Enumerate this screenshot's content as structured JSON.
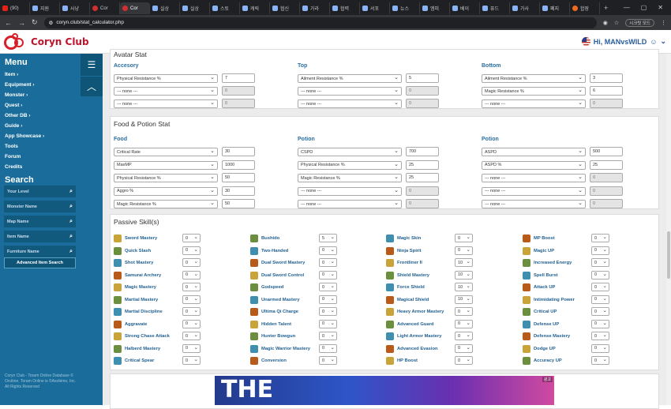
{
  "browser": {
    "tabs": [
      "(90)",
      "지원",
      "사냥",
      "Cor",
      "Cor",
      "실상",
      "실상",
      "스토",
      "캐릭",
      "협신",
      "가라",
      "협력",
      "서포",
      "뉴스",
      "엠피",
      "베이",
      "퓨드",
      "가사",
      "폐지",
      "합장"
    ],
    "active_tab": 4,
    "url": "coryn.club/stat_calculator.php",
    "secret_mode": "시크릿 모드"
  },
  "header": {
    "logo_text": "Coryn Club",
    "greeting": "Hi, MANvsWILD"
  },
  "sidebar": {
    "menu_title": "Menu",
    "items": [
      "Item",
      "Equipment",
      "Monster",
      "Quest",
      "Other DB",
      "Guide",
      "App Showcase",
      "Tools",
      "Forum",
      "Credits"
    ],
    "search_title": "Search",
    "search_fields": [
      "Your Level",
      "Monster Name",
      "Map Name",
      "Item Name",
      "Furniture Name"
    ],
    "advanced_search": "Advanced Item Search",
    "footnote": "Coryn Club - Toram Online Database © Orcitine. Toram Online is ©Asobimo, Inc. All Rights Reserved"
  },
  "avatar": {
    "title_partial": "Avatar Stat",
    "columns": [
      {
        "head": "Accesory",
        "rows": [
          [
            "Physical Resistance %",
            "7",
            false
          ],
          [
            "--- none ---",
            "0",
            true
          ],
          [
            "--- none ---",
            "0",
            true
          ]
        ]
      },
      {
        "head": "Top",
        "rows": [
          [
            "Ailment Resistance %",
            "5",
            false
          ],
          [
            "--- none ---",
            "0",
            true
          ],
          [
            "--- none ---",
            "0",
            true
          ]
        ]
      },
      {
        "head": "Bottom",
        "rows": [
          [
            "Ailment Resistance %",
            "3",
            false
          ],
          [
            "Magic Resistance %",
            "6",
            false
          ],
          [
            "--- none ---",
            "0",
            true
          ]
        ]
      }
    ]
  },
  "food": {
    "title": "Food & Potion Stat",
    "columns": [
      {
        "head": "Food",
        "rows": [
          [
            "Critical Rate",
            "30",
            false
          ],
          [
            "MaxMP",
            "1000",
            false
          ],
          [
            "Physical Resistance %",
            "50",
            false
          ],
          [
            "Aggro %",
            "30",
            false
          ],
          [
            "Magic Resistance %",
            "50",
            false
          ]
        ]
      },
      {
        "head": "Potion",
        "rows": [
          [
            "CSPD",
            "700",
            false
          ],
          [
            "Physical Resistance %",
            "25",
            false
          ],
          [
            "Magic Resistance %",
            "25",
            false
          ],
          [
            "--- none ---",
            "0",
            true
          ],
          [
            "--- none ---",
            "0",
            true
          ]
        ]
      },
      {
        "head": "Potion",
        "rows": [
          [
            "ASPD",
            "500",
            false
          ],
          [
            "ASPD %",
            "25",
            false
          ],
          [
            "--- none ---",
            "0",
            true
          ],
          [
            "--- none ---",
            "0",
            true
          ],
          [
            "--- none ---",
            "0",
            true
          ]
        ]
      }
    ]
  },
  "passive": {
    "title": "Passive Skill(s)",
    "columns": [
      [
        [
          "Sword Mastery",
          "0"
        ],
        [
          "Quick Slash",
          "0"
        ],
        [
          "Shot Mastery",
          "0"
        ],
        [
          "Samurai Archery",
          "0"
        ],
        [
          "Magic Mastery",
          "0"
        ],
        [
          "Martial Mastery",
          "0"
        ],
        [
          "Martial Discipline",
          "0"
        ],
        [
          "Aggravate",
          "0"
        ],
        [
          "Strong Chase Attack",
          "0"
        ],
        [
          "Halberd Mastery",
          "0"
        ],
        [
          "Critical Spear",
          "0"
        ]
      ],
      [
        [
          "Bushido",
          "5"
        ],
        [
          "Two-Handed",
          "0"
        ],
        [
          "Dual Sword Mastery",
          "0"
        ],
        [
          "Dual Sword Control",
          "0"
        ],
        [
          "Godspeed",
          "0"
        ],
        [
          "Unarmed Mastery",
          "0"
        ],
        [
          "Ultima Qi Charge",
          "0"
        ],
        [
          "Hidden Talent",
          "0"
        ],
        [
          "Hunter Bowgun",
          "0"
        ],
        [
          "Magic Warrior Mastery",
          "0"
        ],
        [
          "Conversion",
          "0"
        ]
      ],
      [
        [
          "Magic Skin",
          "0"
        ],
        [
          "Ninja Spirit",
          "0"
        ],
        [
          "Frontliner II",
          "10"
        ],
        [
          "Shield Mastery",
          "10"
        ],
        [
          "Force Shield",
          "10"
        ],
        [
          "Magical Shield",
          "10"
        ],
        [
          "Heavy Armor Mastery",
          "0"
        ],
        [
          "Advanced Guard",
          "0"
        ],
        [
          "Light Armor Mastery",
          "0"
        ],
        [
          "Advanced Evasion",
          "0"
        ],
        [
          "HP Boost",
          "0"
        ]
      ],
      [
        [
          "MP Boost",
          "0"
        ],
        [
          "Magic UP",
          "0"
        ],
        [
          "Increased Energy",
          "0"
        ],
        [
          "Spell Burst",
          "0"
        ],
        [
          "Attack UP",
          "0"
        ],
        [
          "Intimidating Power",
          "0"
        ],
        [
          "Critical UP",
          "0"
        ],
        [
          "Defense UP",
          "0"
        ],
        [
          "Defense Mastery",
          "0"
        ],
        [
          "Dodge UP",
          "0"
        ],
        [
          "Accuracy UP",
          "0"
        ]
      ]
    ],
    "icon_colors": [
      "#c9a43a",
      "#6b8f3e",
      "#3f8fb0",
      "#b85a1a"
    ]
  },
  "ad": {
    "text": "THE",
    "badge": "광고"
  }
}
